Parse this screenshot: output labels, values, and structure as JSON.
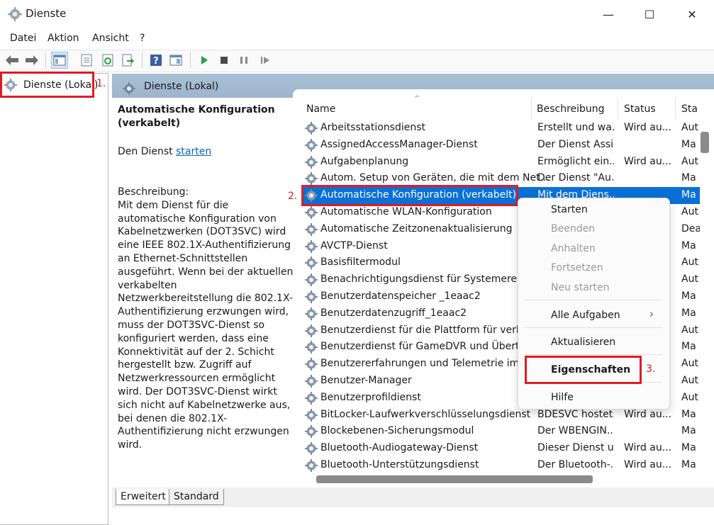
{
  "window": {
    "title": "Dienste",
    "controls": {
      "minimize": "—",
      "maximize": "☐",
      "close": "✕"
    }
  },
  "menubar": [
    "Datei",
    "Aktion",
    "Ansicht",
    "?"
  ],
  "toolbar_icons": [
    "back-arrow-icon",
    "forward-arrow-icon",
    "console-tree-icon",
    "properties-sheet-icon",
    "refresh-icon",
    "export-list-icon",
    "help-icon",
    "show-console-icon",
    "play-icon",
    "stop-icon",
    "pause-icon",
    "resume-icon"
  ],
  "tree": {
    "item": "Dienste (Lokal)"
  },
  "panel": {
    "header": "Dienste (Lokal)",
    "service_title": "Automatische Konfiguration (verkabelt)",
    "start_prefix": "Den Dienst ",
    "start_link": "starten",
    "description_label": "Beschreibung:",
    "description": "Mit dem Dienst für die automatische Konfiguration von Kabelnetzwerken (DOT3SVC) wird eine IEEE 802.1X-Authentifizierung an Ethernet-Schnittstellen ausgeführt. Wenn bei der aktuellen verkabelten Netzwerkbereitstellung die 802.1X-Authentifizierung erzwungen wird, muss der DOT3SVC-Dienst so konfiguriert werden, dass eine Konnektivität auf der 2. Schicht hergestellt bzw. Zugriff auf Netzwerkressourcen ermöglicht wird. Der DOT3SVC-Dienst wirkt sich nicht auf Kabelnetzwerke aus, bei denen die 802.1X-Authentifizierung nicht erzwungen wird."
  },
  "columns": {
    "name": "Name",
    "description": "Beschreibung",
    "status": "Status",
    "startup": "Sta"
  },
  "services": [
    {
      "name": "Arbeitsstationsdienst",
      "desc": "Erstellt und wa...",
      "status": "Wird au...",
      "start": "Aut"
    },
    {
      "name": "AssignedAccessManager-Dienst",
      "desc": "Der Dienst Assi...",
      "status": "",
      "start": "Ma"
    },
    {
      "name": "Aufgabenplanung",
      "desc": "Ermöglicht ein...",
      "status": "Wird au...",
      "start": "Aut"
    },
    {
      "name": "Autom. Setup von Geräten, die mit dem Net...",
      "desc": "Der Dienst \"Au...",
      "status": "",
      "start": "Ma"
    },
    {
      "name": "Automatische Konfiguration (verkabelt)",
      "desc": "Mit dem Diens...",
      "status": "",
      "start": "Ma"
    },
    {
      "name": "Automatische WLAN-Konfiguration",
      "desc": "",
      "status": "",
      "start": "Aut"
    },
    {
      "name": "Automatische Zeitzonenaktualisierung",
      "desc": "",
      "status": "",
      "start": "Dea"
    },
    {
      "name": "AVCTP-Dienst",
      "desc": "",
      "status": "",
      "start": "Ma"
    },
    {
      "name": "Basisfiltermodul",
      "desc": "",
      "status": "",
      "start": "Aut"
    },
    {
      "name": "Benachrichtigungsdienst für Systemereigni",
      "desc": "",
      "status": "",
      "start": "Aut"
    },
    {
      "name": "Benutzerdatenspeicher _1eaac2",
      "desc": "",
      "status": "",
      "start": "Ma"
    },
    {
      "name": "Benutzerdatenzugriff_1eaac2",
      "desc": "",
      "status": "",
      "start": "Ma"
    },
    {
      "name": "Benutzerdienst für die Plattform für verbur",
      "desc": "",
      "status": "",
      "start": "Aut"
    },
    {
      "name": "Benutzerdienst für GameDVR und Übertrag",
      "desc": "",
      "status": "",
      "start": "Ma"
    },
    {
      "name": "Benutzererfahrungen und Telemetrie im ve",
      "desc": "",
      "status": "",
      "start": "Aut"
    },
    {
      "name": "Benutzer-Manager",
      "desc": "",
      "status": "",
      "start": "Aut"
    },
    {
      "name": "Benutzerprofildienst",
      "desc": "",
      "status": "",
      "start": "Aut"
    },
    {
      "name": "BitLocker-Laufwerkverschlüsselungsdienst",
      "desc": "BDESVC hostet...",
      "status": "Wird au...",
      "start": "Ma"
    },
    {
      "name": "Blockebenen-Sicherungsmodul",
      "desc": "Der WBENGIN...",
      "status": "",
      "start": "Ma"
    },
    {
      "name": "Bluetooth-Audiogateway-Dienst",
      "desc": "Dieser Dienst u...",
      "status": "Wird au...",
      "start": "Ma"
    },
    {
      "name": "Bluetooth-Unterstützungsdienst",
      "desc": "Der Bluetooth-...",
      "status": "Wird au...",
      "start": "Ma"
    }
  ],
  "context_menu": {
    "items": [
      {
        "label": "Starten",
        "enabled": true
      },
      {
        "label": "Beenden",
        "enabled": false
      },
      {
        "label": "Anhalten",
        "enabled": false
      },
      {
        "label": "Fortsetzen",
        "enabled": false
      },
      {
        "label": "Neu starten",
        "enabled": false
      },
      {
        "label": "Alle Aufgaben",
        "enabled": true,
        "submenu_arrow": "›"
      },
      {
        "label": "Aktualisieren",
        "enabled": true
      },
      {
        "label": "Eigenschaften",
        "enabled": true
      },
      {
        "label": "Hilfe",
        "enabled": true
      }
    ]
  },
  "tabs": [
    "Erweitert",
    "Standard"
  ],
  "annotations": [
    "1.",
    "2.",
    "3."
  ],
  "colors": {
    "selection": "#0a70d6",
    "annotation_red": "#e01b24",
    "link": "#0b60c4",
    "header_blue": "#a9bfd4"
  }
}
